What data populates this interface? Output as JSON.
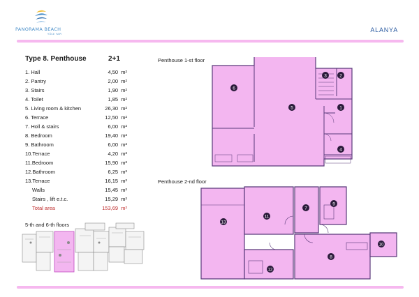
{
  "brand": {
    "name": "PANORAMA BEACH",
    "sub": "YÜCE YAPI"
  },
  "city": "ALANYA",
  "unit": {
    "title": "Type 8. Penthouse",
    "rooms": "2+1"
  },
  "areas": [
    {
      "label": "1. Hall",
      "value": "4,50",
      "unit": "m²"
    },
    {
      "label": "2. Pantry",
      "value": "2,00",
      "unit": "m²"
    },
    {
      "label": "3. Stairs",
      "value": "1,90",
      "unit": "m²"
    },
    {
      "label": "4. Toilet",
      "value": "1,85",
      "unit": "m²"
    },
    {
      "label": "5. Living room & kitchen",
      "value": "26,30",
      "unit": "m²"
    },
    {
      "label": "6. Terrace",
      "value": "12,50",
      "unit": "m²"
    },
    {
      "label": "7. Holl & stairs",
      "value": "6,00",
      "unit": "m²"
    },
    {
      "label": "8. Bedroom",
      "value": "19,40",
      "unit": "m²"
    },
    {
      "label": "9. Bathroom",
      "value": "6,00",
      "unit": "m²"
    },
    {
      "label": "10.Terrace",
      "value": "4,20",
      "unit": "m²"
    },
    {
      "label": "11.Bedroom",
      "value": "15,90",
      "unit": "m²"
    },
    {
      "label": "12.Bathroom",
      "value": "6,25",
      "unit": "m²"
    },
    {
      "label": "13.Terrace",
      "value": "16,15",
      "unit": "m²"
    },
    {
      "label": "Walls",
      "value": "15,45",
      "unit": "m²"
    },
    {
      "label": "Stairs , lift e.t.c.",
      "value": "15,29",
      "unit": "m²"
    },
    {
      "label": "Total area",
      "value": "153,69",
      "unit": "m²"
    }
  ],
  "key_plan_title": "5-th and 6-th floors",
  "plans": {
    "first": {
      "title": "Penthouse 1-st floor",
      "rooms": [
        "1",
        "2",
        "3",
        "4",
        "5",
        "6"
      ]
    },
    "second": {
      "title": "Penthouse 2-nd floor",
      "rooms": [
        "7",
        "8",
        "9",
        "10",
        "11",
        "12",
        "13"
      ]
    }
  },
  "colors": {
    "accent": "#f6b8ef",
    "room_fill": "#f3b6f0",
    "wall": "#5a3a7a",
    "label_bg": "#2b1b3b",
    "brand": "#4a8fc9"
  }
}
